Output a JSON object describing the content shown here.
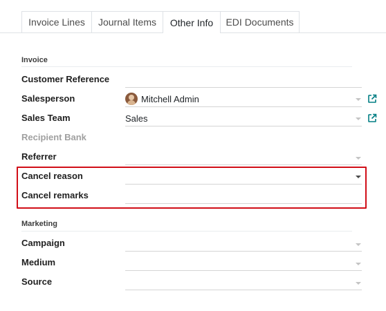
{
  "tabs": [
    {
      "label": "Invoice Lines",
      "active": false
    },
    {
      "label": "Journal Items",
      "active": false
    },
    {
      "label": "Other Info",
      "active": true
    },
    {
      "label": "EDI Documents",
      "active": false
    }
  ],
  "invoice_section": {
    "title": "Invoice",
    "fields": {
      "customer_reference": {
        "label": "Customer Reference",
        "value": ""
      },
      "salesperson": {
        "label": "Salesperson",
        "value": "Mitchell Admin"
      },
      "sales_team": {
        "label": "Sales Team",
        "value": "Sales"
      },
      "recipient_bank": {
        "label": "Recipient Bank",
        "value": ""
      },
      "referrer": {
        "label": "Referrer",
        "value": ""
      },
      "cancel_reason": {
        "label": "Cancel reason",
        "value": ""
      },
      "cancel_remarks": {
        "label": "Cancel remarks",
        "value": ""
      }
    }
  },
  "marketing_section": {
    "title": "Marketing",
    "fields": {
      "campaign": {
        "label": "Campaign",
        "value": ""
      },
      "medium": {
        "label": "Medium",
        "value": ""
      },
      "source": {
        "label": "Source",
        "value": ""
      }
    }
  },
  "icons": {
    "external_link": "external-link-icon",
    "dropdown": "chevron-down-icon",
    "avatar": "user-avatar"
  },
  "colors": {
    "highlight_border": "#d10d17",
    "link_icon": "#017e84"
  }
}
